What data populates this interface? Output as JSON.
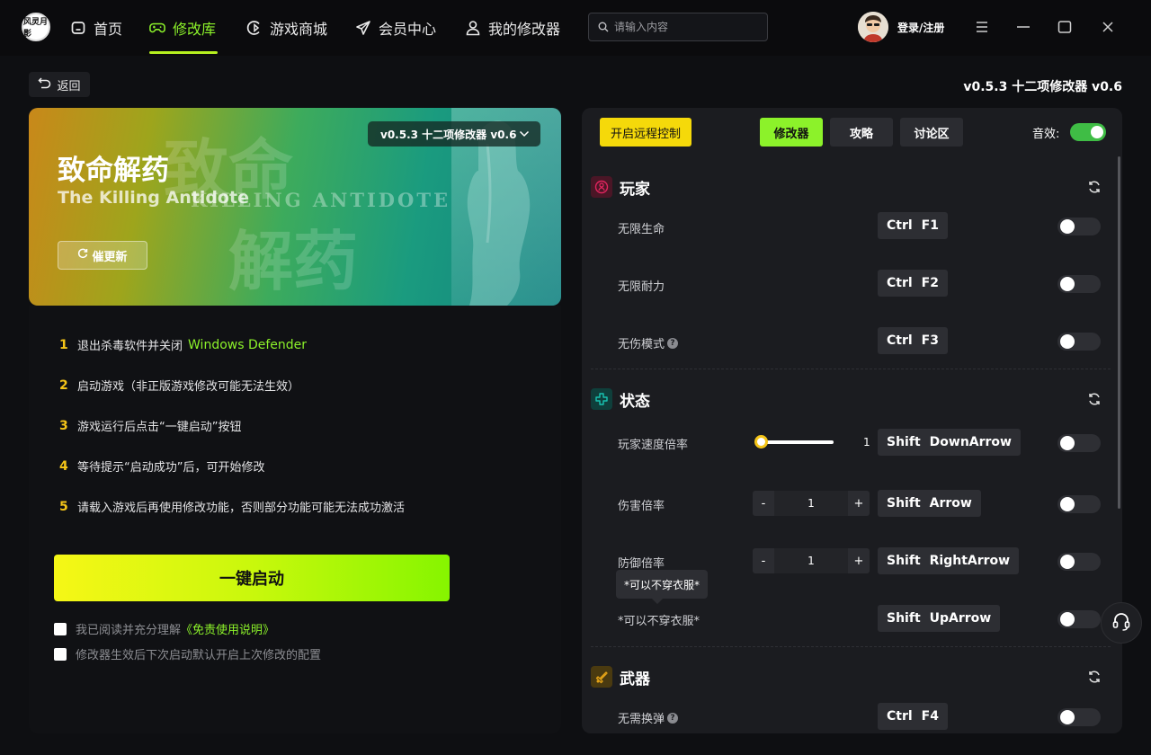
{
  "nav": {
    "logo_text": "风灵月影",
    "items": [
      {
        "label": "首页",
        "icon": "home-icon"
      },
      {
        "label": "修改库",
        "icon": "gamepad-icon"
      },
      {
        "label": "游戏商城",
        "icon": "store-icon"
      },
      {
        "label": "会员中心",
        "icon": "send-icon"
      },
      {
        "label": "我的修改器",
        "icon": "user-icon"
      }
    ],
    "active_index": 1,
    "search_placeholder": "请输入内容",
    "login_label": "登录/注册"
  },
  "subheader": {
    "back_label": "返回",
    "version_title": "v0.5.3 十二项修改器 v0.6"
  },
  "banner": {
    "title": "致命解药",
    "subtitle": "The Killing Antidote",
    "bg_text_cn_1": "致命",
    "bg_text_cn_2": "解药",
    "bg_text_en": "KILLING ANTIDOTE",
    "update_label": "催更新",
    "version_select": "v0.5.3 十二项修改器 v0.6"
  },
  "steps": [
    {
      "num": "1",
      "text": "退出杀毒软件并关闭",
      "highlight": "Windows Defender"
    },
    {
      "num": "2",
      "text": "启动游戏（非正版游戏修改可能无法生效）"
    },
    {
      "num": "3",
      "text": "游戏运行后点击“一键启动”按钮"
    },
    {
      "num": "4",
      "text": "等待提示“启动成功”后，可开始修改"
    },
    {
      "num": "5",
      "text": "请载入游戏后再使用修改功能，否则部分功能可能无法成功激活"
    }
  ],
  "launch_label": "一键启动",
  "checks": [
    {
      "text": "我已阅读并充分理解",
      "link": "《免责使用说明》"
    },
    {
      "text": "修改器生效后下次启动默认开启上次修改的配置"
    }
  ],
  "right": {
    "remote_label": "开启远程控制",
    "tabs": [
      "修改器",
      "攻略",
      "讨论区"
    ],
    "active_tab": 0,
    "sound_label": "音效:",
    "sound_on": true,
    "sections": [
      {
        "title": "玩家",
        "icon": "player-icon",
        "color": "#e0245e",
        "rows": [
          {
            "label": "无限生命",
            "keys": [
              "Ctrl",
              "F1"
            ],
            "on": false
          },
          {
            "label": "无限耐力",
            "keys": [
              "Ctrl",
              "F2"
            ],
            "on": false
          },
          {
            "label": "无伤模式",
            "keys": [
              "Ctrl",
              "F3"
            ],
            "on": false,
            "help": true
          }
        ]
      },
      {
        "title": "状态",
        "icon": "status-icon",
        "color": "#18c4b2",
        "rows": [
          {
            "label": "玩家速度倍率",
            "keys": [
              "Shift",
              "DownArrow"
            ],
            "on": false,
            "slider_value": "1"
          },
          {
            "label": "伤害倍率",
            "keys": [
              "Shift",
              "Arrow"
            ],
            "on": false,
            "stepper_value": "1"
          },
          {
            "label": "防御倍率",
            "keys": [
              "Shift",
              "RightArrow"
            ],
            "on": false,
            "stepper_value": "1"
          },
          {
            "label": "*可以不穿衣服*",
            "keys": [
              "Shift",
              "UpArrow"
            ],
            "on": false
          }
        ]
      },
      {
        "title": "武器",
        "icon": "weapon-icon",
        "color": "#e6a417",
        "rows": [
          {
            "label": "无需换弹",
            "keys": [
              "Ctrl",
              "F4"
            ],
            "on": false,
            "help": true
          }
        ]
      }
    ],
    "stepper_minus": "-",
    "stepper_plus": "+",
    "tooltip": "*可以不穿衣服*"
  }
}
